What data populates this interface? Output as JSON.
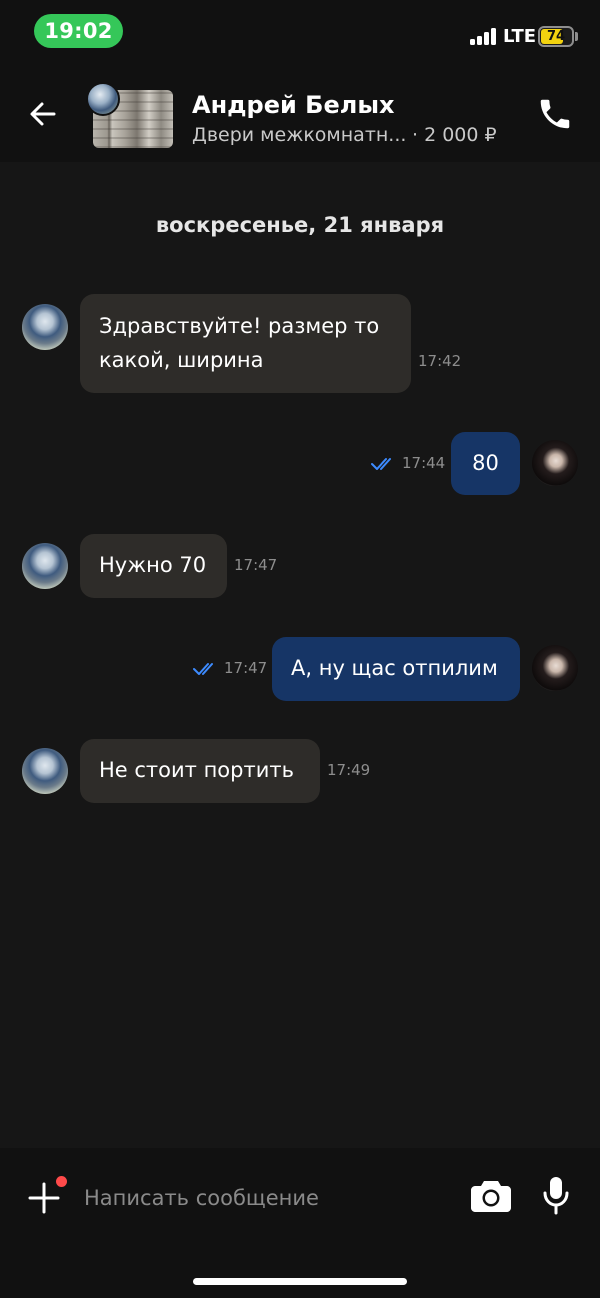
{
  "status_bar": {
    "time": "19:02",
    "network": "LTE",
    "battery_text": "74",
    "battery_level": 0.74
  },
  "header": {
    "contact_name": "Андрей Белых",
    "listing_title": "Двери межкомнатн...",
    "listing_price": "· 2 000 ₽",
    "icons": [
      "back-arrow-icon",
      "phone-icon"
    ]
  },
  "date_separator": "воскресенье, 21 января",
  "messages": [
    {
      "direction": "incoming",
      "text": "Здравствуйте! размер то\nкакой, ширина",
      "time": "17:42"
    },
    {
      "direction": "outgoing",
      "text": "80",
      "time": "17:44",
      "status": "read"
    },
    {
      "direction": "incoming",
      "text": "Нужно 70",
      "time": "17:47"
    },
    {
      "direction": "outgoing",
      "text": "А, ну щас отпилим",
      "time": "17:47",
      "status": "read"
    },
    {
      "direction": "incoming",
      "text": "Не стоит портить",
      "time": "17:49"
    }
  ],
  "composer": {
    "placeholder": "Написать сообщение",
    "value": "",
    "icons": [
      "plus-icon",
      "camera-icon",
      "microphone-icon"
    ]
  },
  "colors": {
    "background": "#161616",
    "bar_background": "#111111",
    "incoming_bubble": "#2e2c29",
    "outgoing_bubble": "#163566",
    "read_ticks": "#3d8bff",
    "time_pill": "#35c759",
    "notification_dot": "#ff4a4a"
  }
}
